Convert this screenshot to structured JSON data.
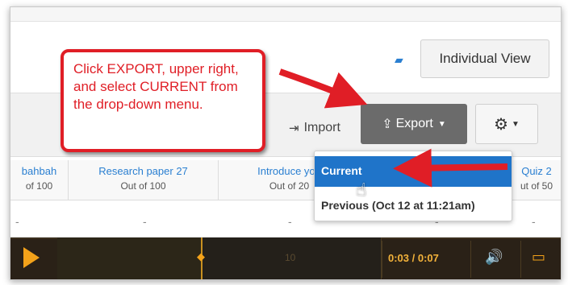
{
  "header": {
    "view_button": "Individual View",
    "view_icon": "badge-icon"
  },
  "toolbar": {
    "import_label": "Import",
    "export_label": "Export",
    "gear_icon": "gear-icon",
    "accent": "#1f74c9",
    "export_bg": "#6b6b6b"
  },
  "callout": {
    "text": "Click EXPORT, upper right, and select CURRENT from the drop-down menu.",
    "border_color": "#e01e26"
  },
  "columns": [
    {
      "name": "bahbah",
      "sub": "of 100"
    },
    {
      "name": "Research paper 27",
      "sub": "Out of 100"
    },
    {
      "name": "Introduce you",
      "sub": "Out of 20"
    },
    {
      "name": "",
      "sub": ""
    },
    {
      "name": "Quiz 2",
      "sub": "ut of 50"
    }
  ],
  "row": [
    "-",
    "-",
    "-",
    "-",
    "-"
  ],
  "dropdown": {
    "current": "Current",
    "previous": "Previous (Oct 12 at 11:21am)"
  },
  "player": {
    "time": "0:03 / 0:07",
    "play_icon": "play-icon",
    "volume_icon": "volume-icon",
    "screen_icon": "screen-icon",
    "timeline_label": "10"
  }
}
